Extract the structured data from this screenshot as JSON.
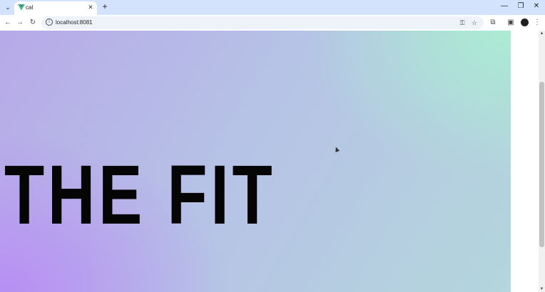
{
  "tab": {
    "title": "cal",
    "close": "✕",
    "new_tab": "+"
  },
  "window": {
    "minimize": "—",
    "restore": "❐",
    "close": "✕",
    "tab_search": "⌄"
  },
  "toolbar": {
    "back": "←",
    "forward": "→",
    "reload": "↻",
    "url": "localhost:8081",
    "info": "i",
    "password_icon": "⚿",
    "star": "☆",
    "extensions": "⧉",
    "side_panel": "▣",
    "menu": "⋮"
  },
  "page": {
    "hero_title": "THE FIT"
  },
  "scrollbar": {
    "up": "▲",
    "down": "▼",
    "position": 0.2
  },
  "colors": {
    "tabstrip": "#d3e3fd",
    "gradient_purple": "#b88cf5",
    "gradient_mint": "#aaeed2",
    "title": "#050505"
  }
}
